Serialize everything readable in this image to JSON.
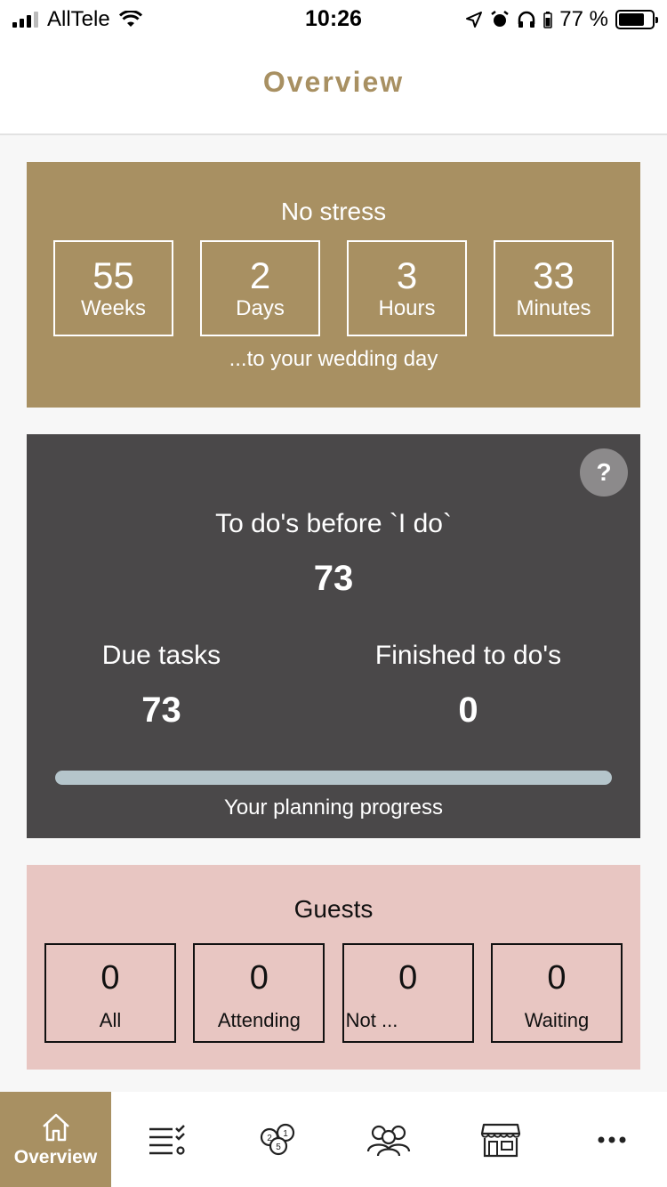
{
  "status_bar": {
    "carrier": "AllTele",
    "time": "10:26",
    "battery_percent": "77 %",
    "battery_level": 0.77
  },
  "header": {
    "title": "Overview"
  },
  "countdown": {
    "heading": "No stress",
    "units": [
      {
        "value": "55",
        "label": "Weeks"
      },
      {
        "value": "2",
        "label": "Days"
      },
      {
        "value": "3",
        "label": "Hours"
      },
      {
        "value": "33",
        "label": "Minutes"
      }
    ],
    "footer": "...to your wedding day"
  },
  "tasks": {
    "help_label": "?",
    "title": "To do's before `I do`",
    "total": "73",
    "due_label": "Due tasks",
    "due_value": "73",
    "finished_label": "Finished to do's",
    "finished_value": "0",
    "progress_fraction": 0,
    "progress_label": "Your planning progress"
  },
  "guests": {
    "title": "Guests",
    "items": [
      {
        "value": "0",
        "label": "All"
      },
      {
        "value": "0",
        "label": "Attending"
      },
      {
        "value": "0",
        "label": "Not ..."
      },
      {
        "value": "0",
        "label": "Waiting"
      }
    ]
  },
  "tabbar": {
    "items": [
      {
        "icon": "home-icon",
        "label": "Overview",
        "active": true
      },
      {
        "icon": "checklist-icon"
      },
      {
        "icon": "coins-icon"
      },
      {
        "icon": "guests-icon"
      },
      {
        "icon": "vendor-shop-icon"
      },
      {
        "icon": "more-icon"
      }
    ]
  },
  "colors": {
    "accent_gold": "#a89062",
    "tasks_bg": "#4a4849",
    "guests_bg": "#e8c6c2",
    "progress_track": "#b5c5cb"
  }
}
